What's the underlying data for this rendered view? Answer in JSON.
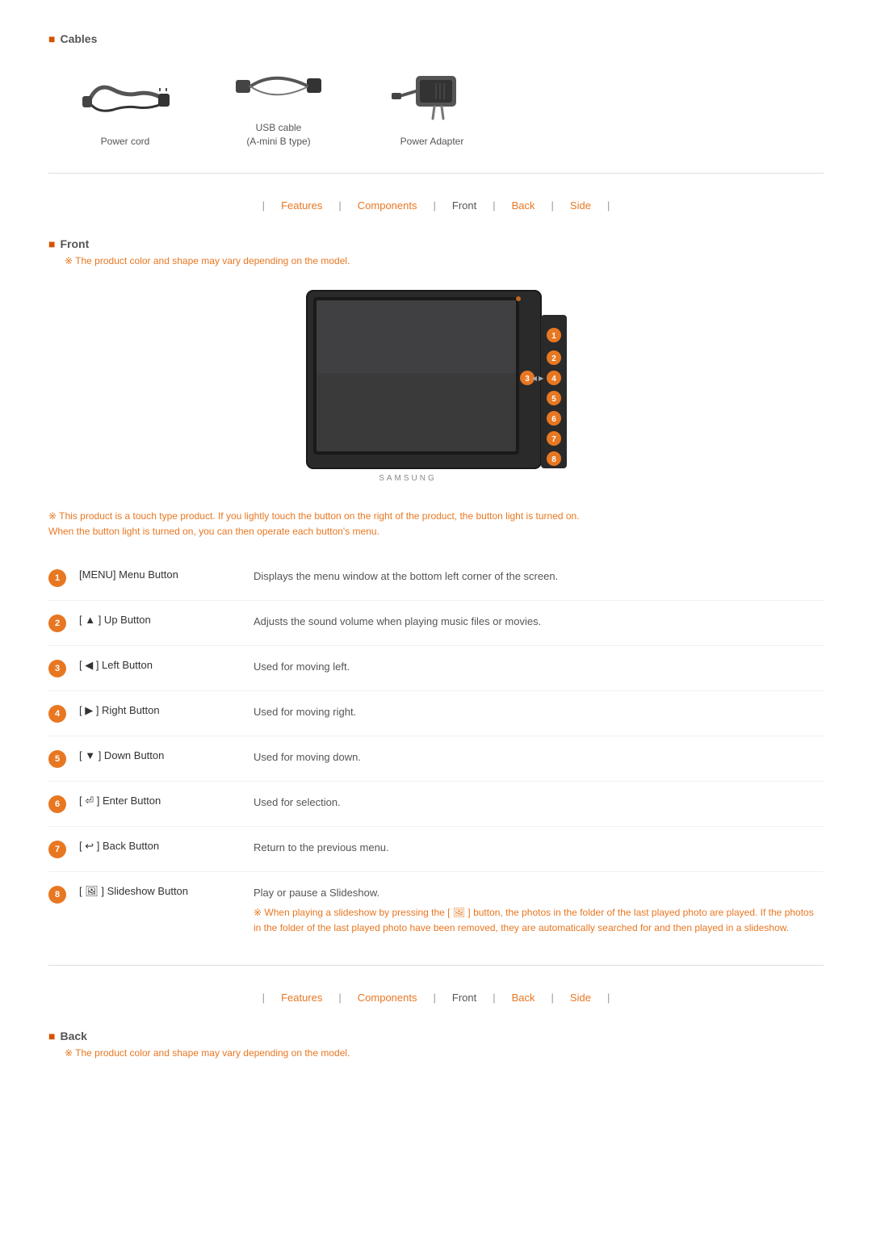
{
  "cables_section": {
    "icon": "■",
    "title": "Cables",
    "items": [
      {
        "name": "Power cord",
        "image_type": "power-cord"
      },
      {
        "name": "USB cable\n(A-mini B type)",
        "image_type": "usb-cable"
      },
      {
        "name": "Power Adapter",
        "image_type": "power-adapter"
      }
    ]
  },
  "nav": {
    "items": [
      "Features",
      "Components",
      "Front",
      "Back",
      "Side"
    ],
    "separators": [
      "|",
      "|",
      "|",
      "|",
      "|"
    ]
  },
  "front_section": {
    "icon": "■",
    "title": "Front",
    "note": "The product color and shape may vary depending on the model.",
    "warning": "This product is a touch type product. If you lightly touch the button on the right of the product, the button light is turned on.\nWhen the button light is turned on, you can then operate each button's menu.",
    "buttons": [
      {
        "num": "1",
        "name": "[MENU] Menu Button",
        "description": "Displays the menu window at the bottom left corner of the screen.",
        "sub_note": null
      },
      {
        "num": "2",
        "name": "[ ▲ ] Up Button",
        "description": "Adjusts the sound volume when playing music files or movies.",
        "sub_note": null
      },
      {
        "num": "3",
        "name": "[ ◀ ] Left Button",
        "description": "Used for moving left.",
        "sub_note": null
      },
      {
        "num": "4",
        "name": "[ ▶ ] Right Button",
        "description": "Used for moving right.",
        "sub_note": null
      },
      {
        "num": "5",
        "name": "[ ▼ ] Down Button",
        "description": "Used for moving down.",
        "sub_note": null
      },
      {
        "num": "6",
        "name": "[ ⏎ ] Enter Button",
        "description": "Used for selection.",
        "sub_note": null
      },
      {
        "num": "7",
        "name": "[ ↩ ] Back Button",
        "description": "Return to the previous menu.",
        "sub_note": null
      },
      {
        "num": "8",
        "name": "[ 🖼 ] Slideshow Button",
        "description": "Play or pause a Slideshow.",
        "sub_note": "When playing a slideshow by pressing the [ 🖼 ] button, the photos in the folder of the last played photo are played. If the photos in the folder of the last played photo have been removed, they are automatically searched for and then played in a slideshow."
      }
    ]
  },
  "back_section": {
    "icon": "■",
    "title": "Back",
    "note": "The product color and shape may vary depending on the model."
  }
}
